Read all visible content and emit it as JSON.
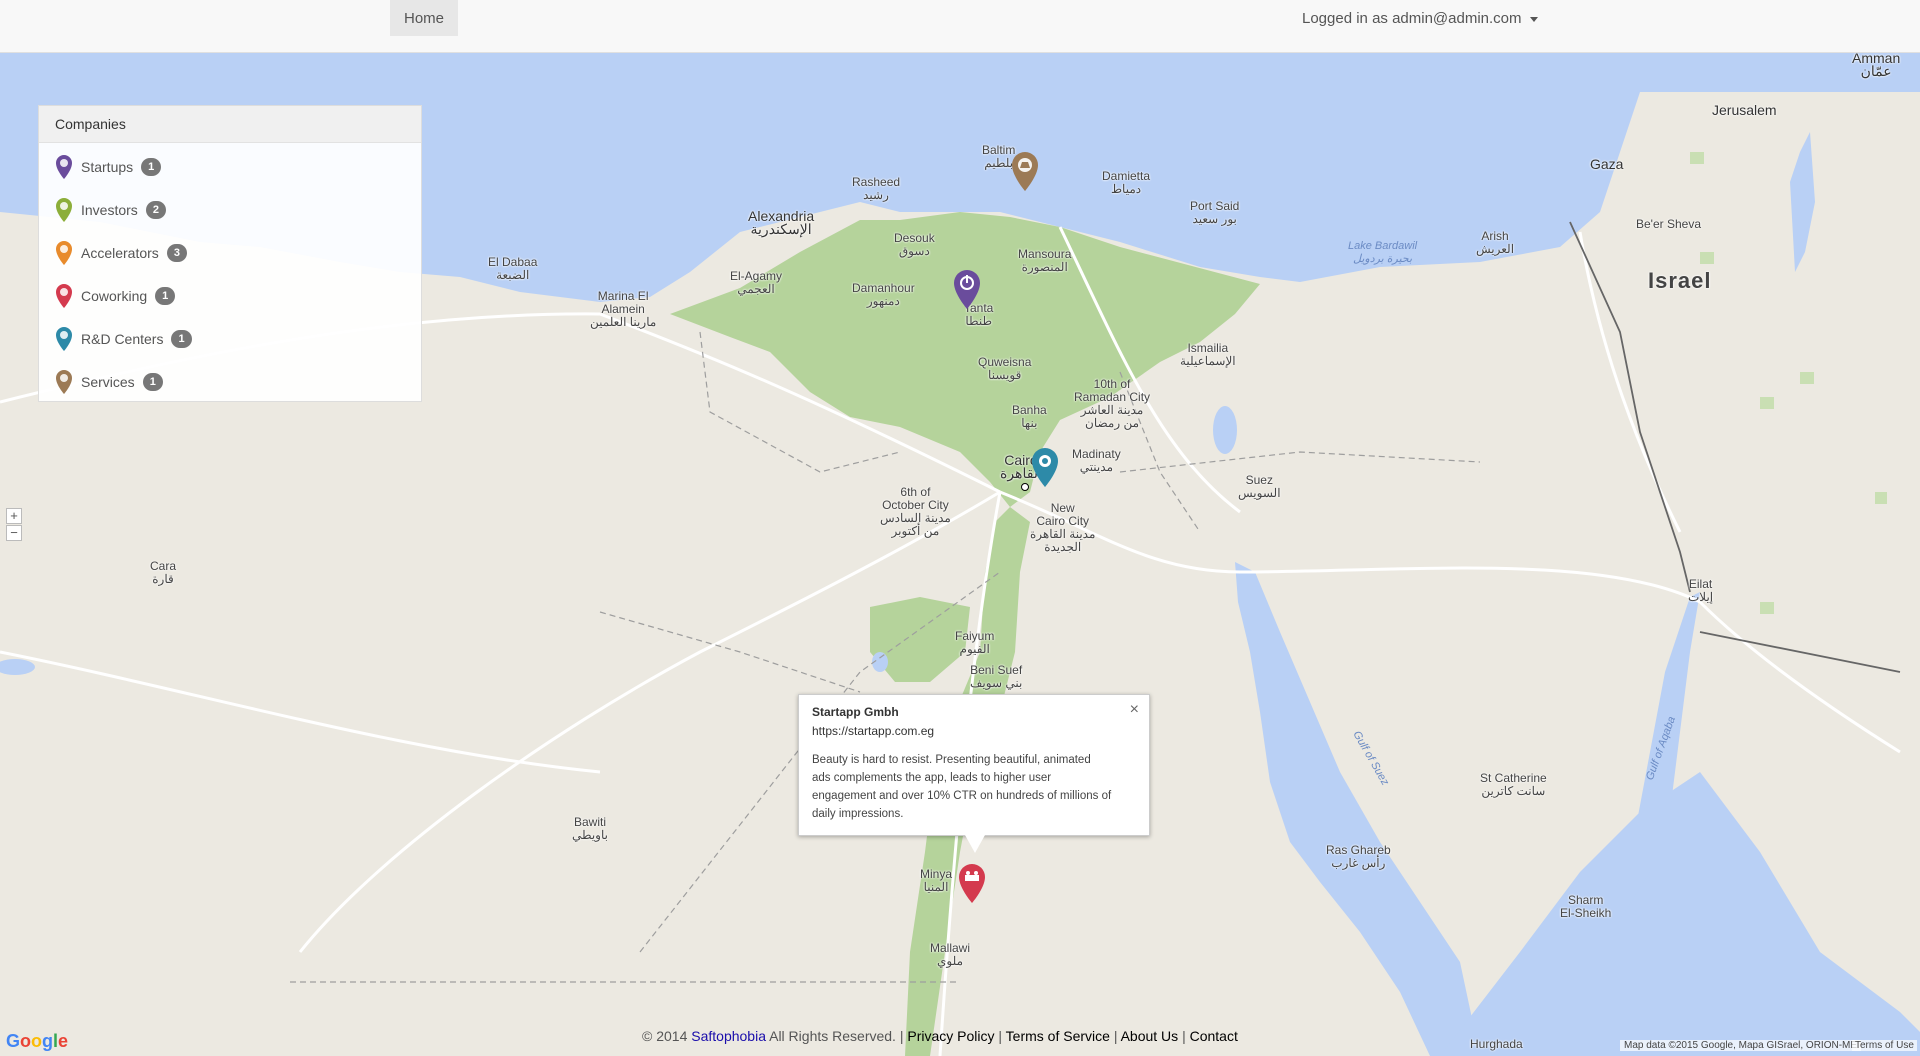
{
  "navbar": {
    "home_label": "Home",
    "user_label": "Logged in as admin@admin.com"
  },
  "panel": {
    "title": "Companies",
    "items": [
      {
        "label": "Startups",
        "count": "1",
        "color": "#6a4c9c",
        "icon": "power-icon"
      },
      {
        "label": "Investors",
        "count": "2",
        "color": "#8cae3a",
        "icon": "dollar-icon"
      },
      {
        "label": "Accelerators",
        "count": "3",
        "color": "#e88b2c",
        "icon": "rocket-icon"
      },
      {
        "label": "Coworking",
        "count": "1",
        "color": "#d43a4e",
        "icon": "people-icon"
      },
      {
        "label": "R&D Centers",
        "count": "1",
        "color": "#2d8aa8",
        "icon": "flask-icon"
      },
      {
        "label": "Services",
        "count": "1",
        "color": "#9c7a55",
        "icon": "gear-icon"
      }
    ]
  },
  "zoom": {
    "in": "+",
    "out": "−"
  },
  "infowindow": {
    "title": "Startapp Gmbh",
    "url": "https://startapp.com.eg",
    "description": "Beauty is hard to resist. Presenting beautiful, animated ads complements the app, leads to higher user engagement and over 10% CTR on hundreds of millions of daily impressions.",
    "close": "×"
  },
  "map_labels": {
    "alexandria": "Alexandria\nالإسكندرية",
    "cairo": "Cairo\nالقاهرة",
    "israel": "Israel",
    "amman": "Amman\nعمّان",
    "jerusalem": "Jerusalem",
    "gaza": "Gaza",
    "port_said": "Port Said\nبور سعيد",
    "damietta": "Damietta\nدمياط",
    "mansoura": "Mansoura\nالمنصورة",
    "tanta": "Tanta\nطنطا",
    "damanhour": "Damanhour\nدمنهور",
    "rasheed": "Rasheed\nرشيد",
    "baltim": "Baltim\nبلطيم",
    "desouk": "Desouk\nدسوق",
    "el_agamy": "El-Agamy\nالعجمي",
    "ismailia": "Ismailia\nالإسماعيلية",
    "suez": "Suez\nالسويس",
    "faiyum": "Faiyum\nالفيوم",
    "beni_suef": "Beni Suef\nبني سويف",
    "minya": "Minya\nالمنيا",
    "mallawi": "Mallawi\nملوي",
    "hurghada": "Hurghada",
    "sharm": "Sharm\nEl-Sheikh",
    "eilat": "Eilat\nإيلات",
    "arish": "Arish\nالعريش",
    "beer_sheva": "Be'er Sheva",
    "sixth_october": "6th of\nOctober City\nمدينة السادس\nمن أكتوبر",
    "new_cairo": "New\nCairo City\nمدينة القاهرة\nالجديدة",
    "tenth_ramadan": "10th of\nRamadan City\nمدينة العاشر\nمن رمضان",
    "madinaty": "Madinaty\nمدينتي",
    "quweisna": "Quweisna\nقويسنا",
    "banha": "Banha\nبنها",
    "st_catherine": "St Catherine\nسانت كاترين",
    "ras_gharib": "Ras Ghareb\nرأس غارب",
    "el_dabaa": "El Dabaa\nالضبعة",
    "marina": "Marina El\nAlamein\nمارينا العلمين",
    "bawiti": "Bawiti\nباويطي",
    "cara": "Cara\nقارة",
    "lake_bardawil": "Lake Bardawil\nبحيرة بردويل",
    "gulf_suez": "Gulf of Suez",
    "gulf_aqaba": "Gulf of Aqaba"
  },
  "footer": {
    "copyright": "© 2014",
    "brand": "Saftophobia",
    "rights": "All Rights Reserved.",
    "privacy": "Privacy Policy",
    "terms": "Terms of Service",
    "about": "About Us",
    "contact": "Contact"
  },
  "map_attribution": "Map data ©2015 Google, Mapa GISrael, ORION-ME",
  "terms_of_use": "Terms of Use",
  "google_logo": "Google",
  "colors": {
    "sea": "#b9d0f5",
    "delta": "#b5d39b",
    "land": "#ece9e1",
    "red_sea": "#b9d0f5"
  }
}
